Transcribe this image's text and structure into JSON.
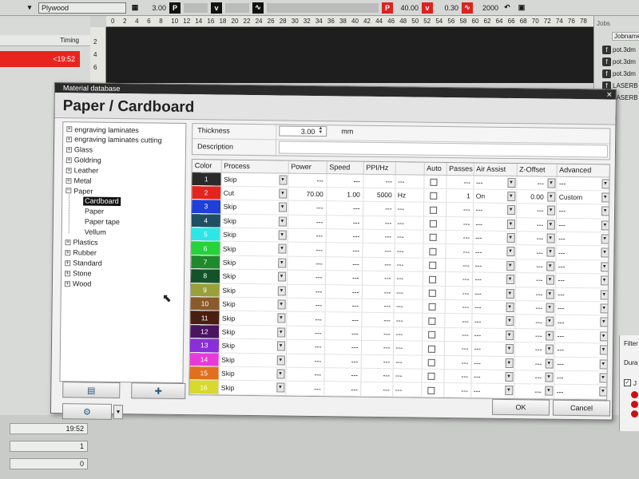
{
  "toolbar": {
    "material": "Plywood",
    "value1": "3.00",
    "power_icon": "P",
    "velocity_icon": "v",
    "power": "40.00",
    "velocity": "0.30",
    "frequency": "2000"
  },
  "ruler_ticks": [
    "0",
    "2",
    "4",
    "6",
    "8",
    "10",
    "12",
    "14",
    "16",
    "18",
    "20",
    "22",
    "24",
    "26",
    "28",
    "30",
    "32",
    "34",
    "36",
    "38",
    "40",
    "42",
    "44",
    "46",
    "48",
    "50",
    "52",
    "54",
    "56",
    "58",
    "60",
    "62",
    "64",
    "66",
    "68",
    "70",
    "72",
    "74",
    "76",
    "78"
  ],
  "vruler_ticks": [
    "2",
    "4",
    "6"
  ],
  "left_panel": {
    "timing_label": "Timing",
    "timing_value": "<19:52",
    "stat1": "19:52",
    "stat2": "1",
    "stat3": "0"
  },
  "jobs": {
    "title": "Jobs",
    "column": "Jobname",
    "items": [
      "pot.3dm",
      "pot.3dm",
      "pot.3dm",
      "LASERB",
      "LASERB"
    ],
    "filter_label": "Filter",
    "duration_label": "Dura",
    "check_label": "J"
  },
  "dialog": {
    "title": "Material database",
    "heading": "Paper / Cardboard",
    "thickness_label": "Thickness",
    "thickness_value": "3.00",
    "thickness_unit": "mm",
    "description_label": "Description",
    "ok": "OK",
    "cancel": "Cancel"
  },
  "tree": {
    "top": [
      "engraving laminates",
      "engraving laminates cutting",
      "Glass",
      "Goldring",
      "Leather",
      "Metal",
      "Paper"
    ],
    "children": [
      "Cardboard",
      "Paper",
      "Paper tape",
      "Vellum"
    ],
    "rest": [
      "Plastics",
      "Rubber",
      "Standard",
      "Stone",
      "Wood"
    ]
  },
  "table": {
    "headers": [
      "Color",
      "Process",
      "Power",
      "Speed",
      "PPI/Hz",
      "",
      "Auto",
      "Passes",
      "Air Assist",
      "Z-Offset",
      "Advanced"
    ],
    "rows": [
      {
        "n": "1",
        "color": "#2a2a2a",
        "process": "Skip",
        "power": "---",
        "speed": "---",
        "ppi": "---",
        "unit": "---",
        "passes": "---",
        "air": "---",
        "z": "---",
        "adv": "---"
      },
      {
        "n": "2",
        "color": "#e3241e",
        "process": "Cut",
        "power": "70.00",
        "speed": "1.00",
        "ppi": "5000",
        "unit": "Hz",
        "passes": "1",
        "air": "On",
        "z": "0.00",
        "adv": "Custom"
      },
      {
        "n": "3",
        "color": "#1f3fd8",
        "process": "Skip",
        "power": "---",
        "speed": "---",
        "ppi": "---",
        "unit": "---",
        "passes": "---",
        "air": "---",
        "z": "---",
        "adv": "---"
      },
      {
        "n": "4",
        "color": "#1e4f64",
        "process": "Skip",
        "power": "---",
        "speed": "---",
        "ppi": "---",
        "unit": "---",
        "passes": "---",
        "air": "---",
        "z": "---",
        "adv": "---"
      },
      {
        "n": "5",
        "color": "#2ee6e6",
        "process": "Skip",
        "power": "---",
        "speed": "---",
        "ppi": "---",
        "unit": "---",
        "passes": "---",
        "air": "---",
        "z": "---",
        "adv": "---"
      },
      {
        "n": "6",
        "color": "#27d23a",
        "process": "Skip",
        "power": "---",
        "speed": "---",
        "ppi": "---",
        "unit": "---",
        "passes": "---",
        "air": "---",
        "z": "---",
        "adv": "---"
      },
      {
        "n": "7",
        "color": "#1f8a2d",
        "process": "Skip",
        "power": "---",
        "speed": "---",
        "ppi": "---",
        "unit": "---",
        "passes": "---",
        "air": "---",
        "z": "---",
        "adv": "---"
      },
      {
        "n": "8",
        "color": "#14522a",
        "process": "Skip",
        "power": "---",
        "speed": "---",
        "ppi": "---",
        "unit": "---",
        "passes": "---",
        "air": "---",
        "z": "---",
        "adv": "---"
      },
      {
        "n": "9",
        "color": "#9aa03a",
        "process": "Skip",
        "power": "---",
        "speed": "---",
        "ppi": "---",
        "unit": "---",
        "passes": "---",
        "air": "---",
        "z": "---",
        "adv": "---"
      },
      {
        "n": "10",
        "color": "#8a5a2a",
        "process": "Skip",
        "power": "---",
        "speed": "---",
        "ppi": "---",
        "unit": "---",
        "passes": "---",
        "air": "---",
        "z": "---",
        "adv": "---"
      },
      {
        "n": "11",
        "color": "#4a1e10",
        "process": "Skip",
        "power": "---",
        "speed": "---",
        "ppi": "---",
        "unit": "---",
        "passes": "---",
        "air": "---",
        "z": "---",
        "adv": "---"
      },
      {
        "n": "12",
        "color": "#4a1460",
        "process": "Skip",
        "power": "---",
        "speed": "---",
        "ppi": "---",
        "unit": "---",
        "passes": "---",
        "air": "---",
        "z": "---",
        "adv": "---"
      },
      {
        "n": "13",
        "color": "#8a2fd8",
        "process": "Skip",
        "power": "---",
        "speed": "---",
        "ppi": "---",
        "unit": "---",
        "passes": "---",
        "air": "---",
        "z": "---",
        "adv": "---"
      },
      {
        "n": "14",
        "color": "#e83ad8",
        "process": "Skip",
        "power": "---",
        "speed": "---",
        "ppi": "---",
        "unit": "---",
        "passes": "---",
        "air": "---",
        "z": "---",
        "adv": "---"
      },
      {
        "n": "15",
        "color": "#e0701e",
        "process": "Skip",
        "power": "---",
        "speed": "---",
        "ppi": "---",
        "unit": "---",
        "passes": "---",
        "air": "---",
        "z": "---",
        "adv": "---"
      },
      {
        "n": "16",
        "color": "#d8d82e",
        "process": "Skip",
        "power": "---",
        "speed": "---",
        "ppi": "---",
        "unit": "---",
        "passes": "---",
        "air": "---",
        "z": "---",
        "adv": "---"
      }
    ]
  }
}
